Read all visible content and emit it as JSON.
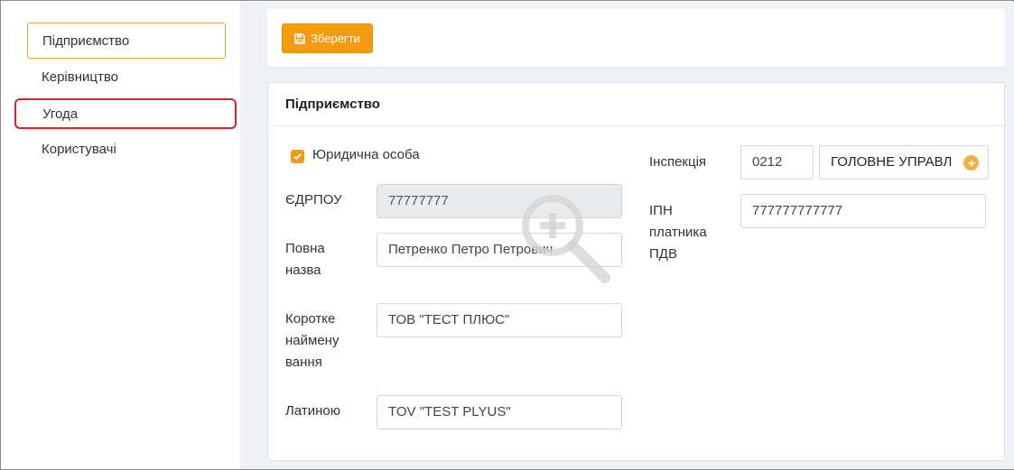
{
  "sidebar": {
    "items": [
      {
        "label": "Підприємство"
      },
      {
        "label": "Керівництво"
      },
      {
        "label": "Угода"
      },
      {
        "label": "Користувачі"
      }
    ]
  },
  "toolbar": {
    "save_label": "Зберегти"
  },
  "form": {
    "title": "Підприємство",
    "legal_entity_label": "Юридична особа",
    "edrpou": {
      "label": "ЄДРПОУ",
      "value": "77777777"
    },
    "full_name": {
      "label_line1": "Повна",
      "label_line2": "назва",
      "value": "Петренко Петро Петрович"
    },
    "short_name": {
      "label_line1": "Коротке",
      "label_line2": "наймену",
      "label_line3": "вання",
      "value": "ТОВ \"ТЕСТ ПЛЮС\""
    },
    "latin": {
      "label": "Латиною",
      "value": "TOV \"TEST PLYUS\""
    },
    "inspection": {
      "label": "Інспекція",
      "code": "0212",
      "name": "ГОЛОВНЕ УПРАВЛ"
    },
    "ipn": {
      "label_line1": "ІПН",
      "label_line2": "платника",
      "label_line3": "ПДВ",
      "value": "777777777777"
    }
  },
  "colors": {
    "accent": "#f39c12",
    "highlight": "#e0202a"
  }
}
